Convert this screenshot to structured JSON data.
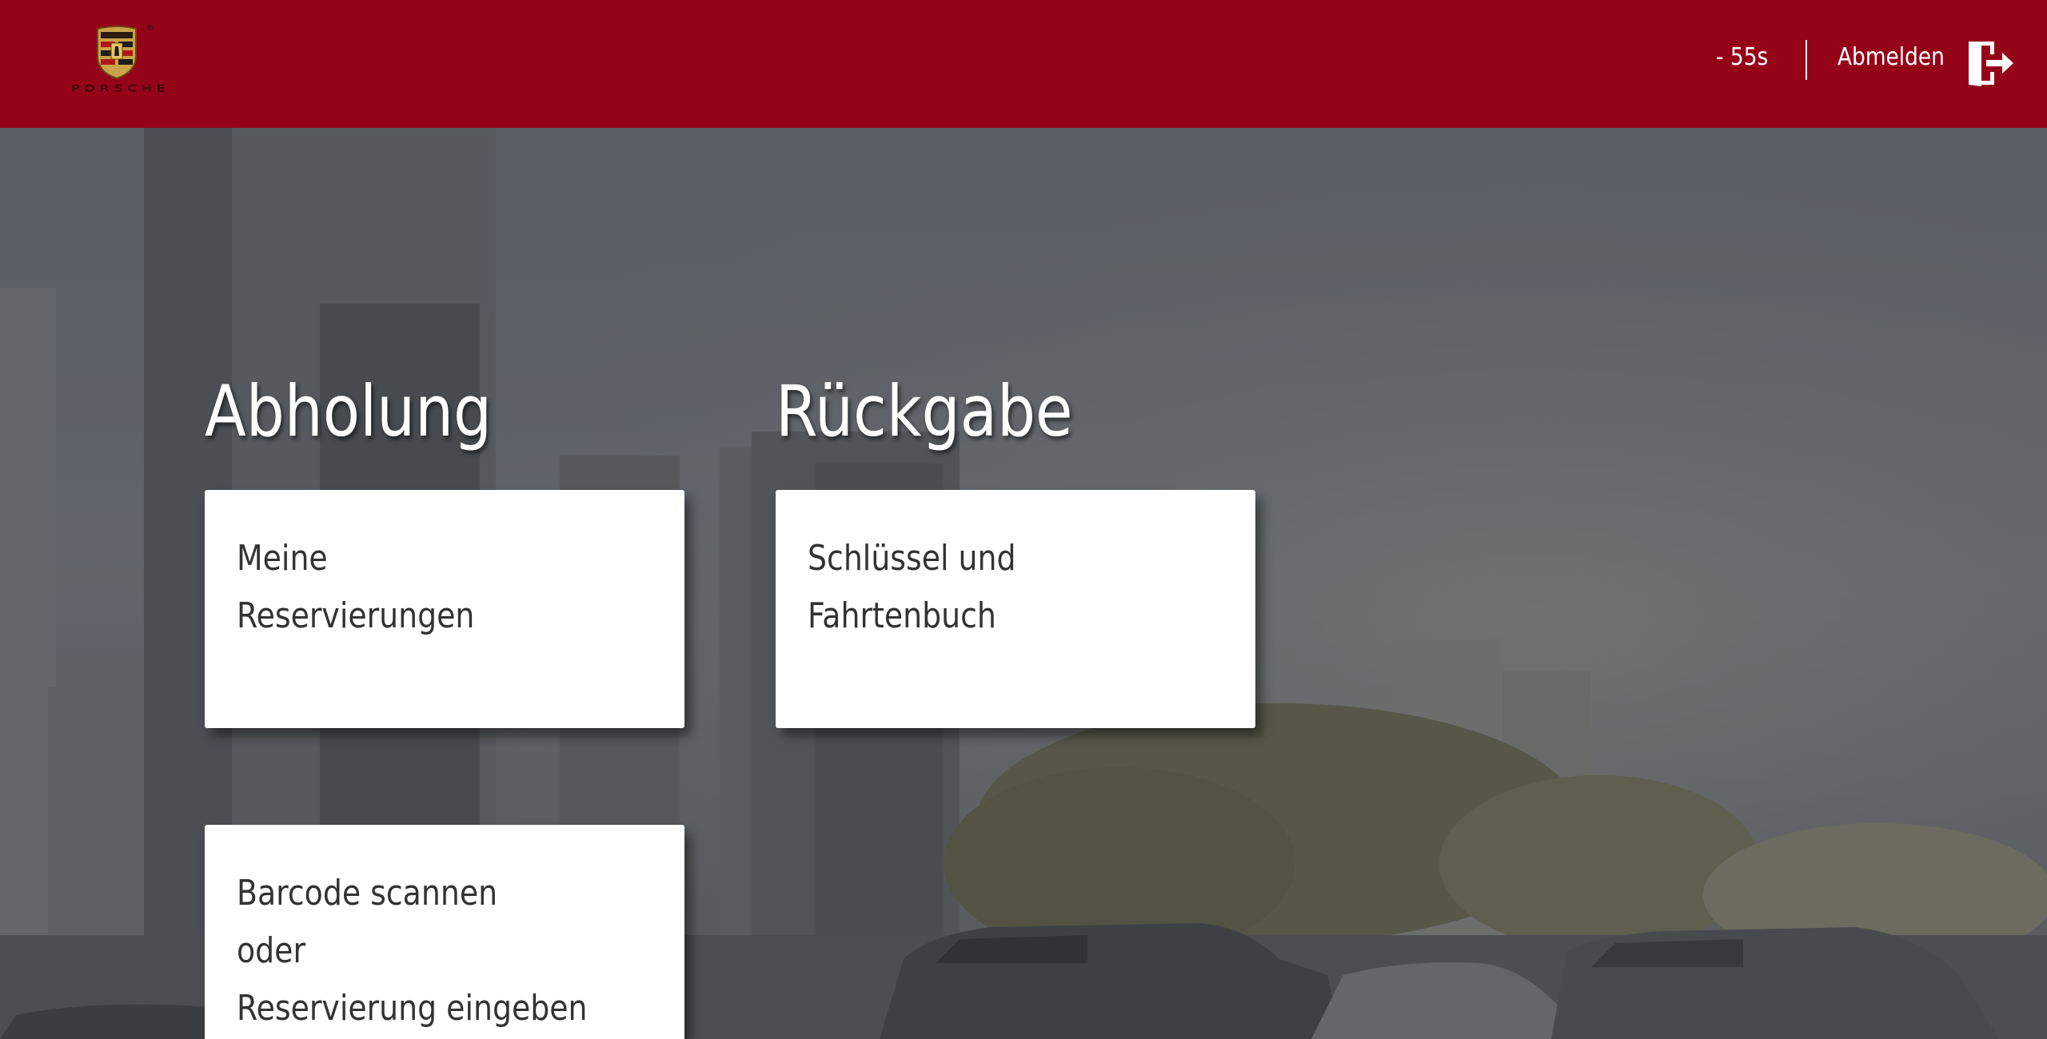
{
  "brand": {
    "name": "PORSCHE",
    "registered_mark": "®",
    "primary_color": "#950318"
  },
  "header": {
    "timer": "- 55s",
    "logout_label": "Abmelden",
    "logout_icon": "logout-door-icon"
  },
  "sections": {
    "pickup": {
      "title": "Abholung",
      "tiles": [
        {
          "lines": [
            "Meine",
            "Reservierungen"
          ]
        },
        {
          "lines": [
            "Barcode scannen",
            "oder",
            "Reservierung eingeben"
          ]
        }
      ]
    },
    "return": {
      "title": "Rückgabe",
      "tiles": [
        {
          "lines": [
            "Schlüssel und",
            "Fahrtenbuch"
          ]
        }
      ]
    }
  }
}
